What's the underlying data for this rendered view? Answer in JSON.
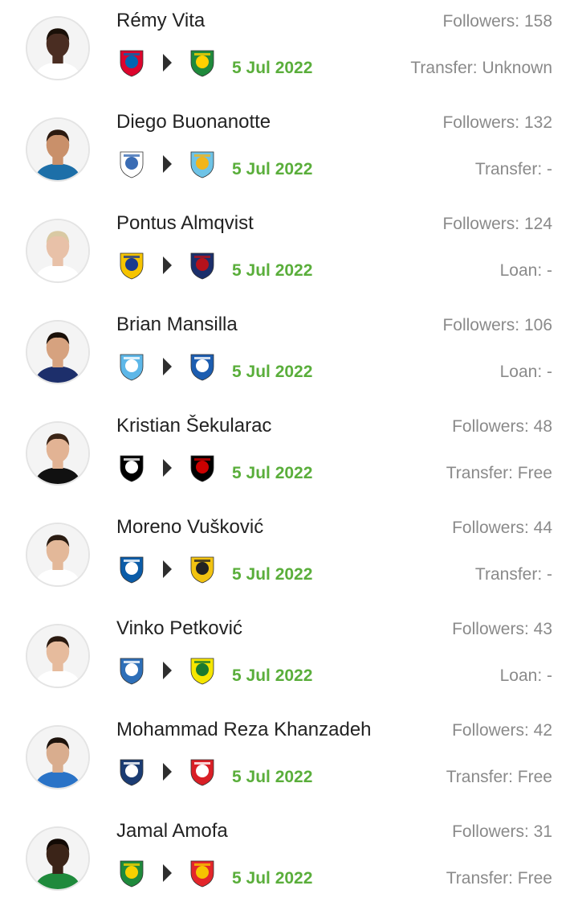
{
  "arrow_icon": "triangle-right-icon",
  "colors": {
    "date": "#5aae3b",
    "secondary_text": "#8a8a8a",
    "name_text": "#222222"
  },
  "transfers": [
    {
      "name": "Rémy Vita",
      "followers": "Followers: 158",
      "fee": "Transfer: Unknown",
      "date": "5 Jul 2022",
      "skin": "#4a2d22",
      "hair": "#1a1008",
      "shirt": "#ffffff",
      "from_club": {
        "icon": "bayern-munchen-crest",
        "c1": "#dc052d",
        "c2": "#0066b2"
      },
      "to_club": {
        "icon": "fortuna-sittard-crest",
        "c1": "#1f8a3c",
        "c2": "#ffd100"
      }
    },
    {
      "name": "Diego Buonanotte",
      "followers": "Followers: 132",
      "fee": "Transfer: -",
      "date": "5 Jul 2022",
      "skin": "#c9906a",
      "hair": "#2b1a10",
      "shirt": "#1d6fa8",
      "from_club": {
        "icon": "la-guaira-crest",
        "c1": "#ffffff",
        "c2": "#3a6cb4"
      },
      "to_club": {
        "icon": "sporting-cristal-crest",
        "c1": "#6ec3e6",
        "c2": "#f2b51b"
      }
    },
    {
      "name": "Pontus Almqvist",
      "followers": "Followers: 124",
      "fee": "Loan: -",
      "date": "5 Jul 2022",
      "skin": "#e8c1a8",
      "hair": "#d9c9a3",
      "shirt": "#ffffff",
      "from_club": {
        "icon": "rostov-crest",
        "c1": "#f6c400",
        "c2": "#1a3a8f"
      },
      "to_club": {
        "icon": "pogon-szczecin-crest",
        "c1": "#1b2f6b",
        "c2": "#b5121b"
      }
    },
    {
      "name": "Brian Mansilla",
      "followers": "Followers: 106",
      "fee": "Loan: -",
      "date": "5 Jul 2022",
      "skin": "#d6a27f",
      "hair": "#1a1008",
      "shirt": "#1d2f6b",
      "from_club": {
        "icon": "racing-club-crest",
        "c1": "#5db7e8",
        "c2": "#ffffff"
      },
      "to_club": {
        "icon": "orenburg-crest",
        "c1": "#1c5db0",
        "c2": "#ffffff"
      }
    },
    {
      "name": "Kristian Šekularac",
      "followers": "Followers: 48",
      "fee": "Transfer: Free",
      "date": "5 Jul 2022",
      "skin": "#e2b394",
      "hair": "#3a2415",
      "shirt": "#111111",
      "from_club": {
        "icon": "juventus-crest",
        "c1": "#000000",
        "c2": "#ffffff"
      },
      "to_club": {
        "icon": "fulham-crest",
        "c1": "#000000",
        "c2": "#cc0000"
      }
    },
    {
      "name": "Moreno Vušković",
      "followers": "Followers: 44",
      "fee": "Transfer: -",
      "date": "5 Jul 2022",
      "skin": "#e3b899",
      "hair": "#2a1c12",
      "shirt": "#ffffff",
      "from_club": {
        "icon": "dinamo-zagreb-crest",
        "c1": "#0b5ca8",
        "c2": "#ffffff"
      },
      "to_club": {
        "icon": "hajduk-crest",
        "c1": "#f2c311",
        "c2": "#222222"
      }
    },
    {
      "name": "Vinko Petković",
      "followers": "Followers: 43",
      "fee": "Loan: -",
      "date": "5 Jul 2022",
      "skin": "#e6bb9d",
      "hair": "#2a1a10",
      "shirt": "#ffffff",
      "from_club": {
        "icon": "nk-osijek-crest",
        "c1": "#2e6fb8",
        "c2": "#ffffff"
      },
      "to_club": {
        "icon": "metalist-crest",
        "c1": "#f6e600",
        "c2": "#1a7a2e"
      }
    },
    {
      "name": "Mohammad Reza Khanzadeh",
      "followers": "Followers: 42",
      "fee": "Transfer: Free",
      "date": "5 Jul 2022",
      "skin": "#d9ad8e",
      "hair": "#1d130c",
      "shirt": "#2a73c7",
      "from_club": {
        "icon": "paykan-crest",
        "c1": "#1b3c73",
        "c2": "#ffffff"
      },
      "to_club": {
        "icon": "tractor-crest",
        "c1": "#d91f26",
        "c2": "#ffffff"
      }
    },
    {
      "name": "Jamal Amofa",
      "followers": "Followers: 31",
      "fee": "Transfer: Free",
      "date": "5 Jul 2022",
      "skin": "#3b2418",
      "hair": "#120a05",
      "shirt": "#1f8a3c",
      "from_club": {
        "icon": "ado-den-haag-crest",
        "c1": "#1f8a3c",
        "c2": "#f6d100"
      },
      "to_club": {
        "icon": "go-ahead-eagles-crest",
        "c1": "#e3262b",
        "c2": "#f6c400"
      }
    }
  ]
}
